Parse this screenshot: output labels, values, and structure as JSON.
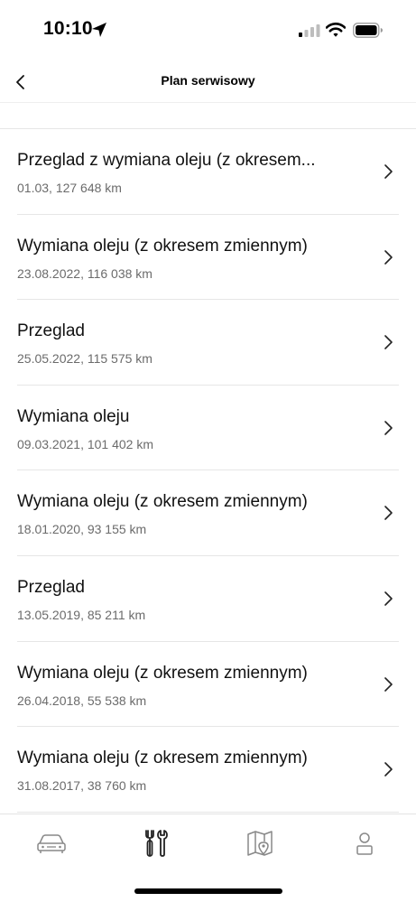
{
  "status_bar": {
    "time": "10:10",
    "icons": [
      "location-arrow-icon",
      "signal-icon",
      "wifi-icon",
      "battery-icon"
    ]
  },
  "nav": {
    "title": "Plan serwisowy",
    "back_icon": "chevron-left-icon"
  },
  "list": {
    "items": [
      {
        "title": "Przeglad z wymiana oleju (z okresem...",
        "subtitle": "01.03, 127 648 km"
      },
      {
        "title": "Wymiana oleju (z okresem zmiennym)",
        "subtitle": "23.08.2022, 116 038 km"
      },
      {
        "title": "Przeglad",
        "subtitle": "25.05.2022, 115 575 km"
      },
      {
        "title": "Wymiana oleju",
        "subtitle": "09.03.2021, 101 402 km"
      },
      {
        "title": "Wymiana oleju (z okresem zmiennym)",
        "subtitle": "18.01.2020, 93 155 km"
      },
      {
        "title": "Przeglad",
        "subtitle": "13.05.2019, 85 211 km"
      },
      {
        "title": "Wymiana oleju (z okresem zmiennym)",
        "subtitle": "26.04.2018, 55 538 km"
      },
      {
        "title": "Wymiana oleju (z okresem zmiennym)",
        "subtitle": "31.08.2017, 38 760 km"
      }
    ]
  },
  "tab_bar": {
    "tabs": [
      {
        "icon": "car-icon",
        "active": false
      },
      {
        "icon": "tools-icon",
        "active": true
      },
      {
        "icon": "map-icon",
        "active": false
      },
      {
        "icon": "profile-icon",
        "active": false
      }
    ]
  },
  "colors": {
    "text_primary": "#111111",
    "text_secondary": "#6b6b6b",
    "divider": "#e6e6e6",
    "icon_inactive": "#888888",
    "icon_active": "#222222"
  }
}
